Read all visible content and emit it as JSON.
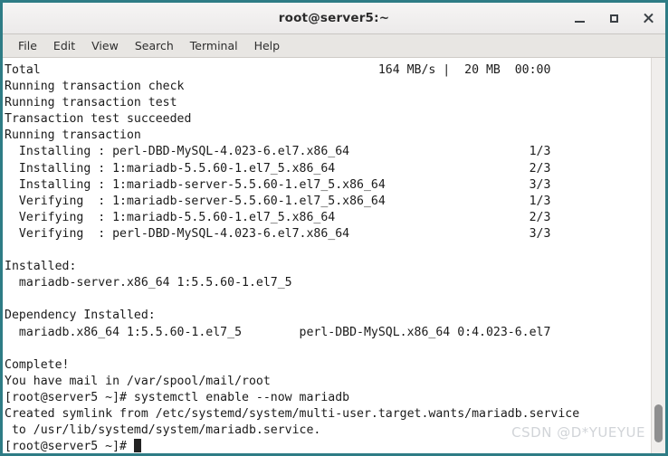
{
  "window": {
    "title": "root@server5:~",
    "border_color": "#2e7c85",
    "controls": {
      "minimize_label": "–",
      "maximize_label": "□",
      "close_label": "✕"
    }
  },
  "menubar": {
    "items": [
      {
        "label": "File"
      },
      {
        "label": "Edit"
      },
      {
        "label": "View"
      },
      {
        "label": "Search"
      },
      {
        "label": "Terminal"
      },
      {
        "label": "Help"
      }
    ]
  },
  "terminal": {
    "background": "#ffffff",
    "foreground": "#1b1b1b",
    "prompt": "[root@server5 ~]#",
    "lines": [
      "Total                                               164 MB/s |  20 MB  00:00",
      "Running transaction check",
      "Running transaction test",
      "Transaction test succeeded",
      "Running transaction",
      "  Installing : perl-DBD-MySQL-4.023-6.el7.x86_64                         1/3",
      "  Installing : 1:mariadb-5.5.60-1.el7_5.x86_64                           2/3",
      "  Installing : 1:mariadb-server-5.5.60-1.el7_5.x86_64                    3/3",
      "  Verifying  : 1:mariadb-server-5.5.60-1.el7_5.x86_64                    1/3",
      "  Verifying  : 1:mariadb-5.5.60-1.el7_5.x86_64                           2/3",
      "  Verifying  : perl-DBD-MySQL-4.023-6.el7.x86_64                         3/3",
      "",
      "Installed:",
      "  mariadb-server.x86_64 1:5.5.60-1.el7_5",
      "",
      "Dependency Installed:",
      "  mariadb.x86_64 1:5.5.60-1.el7_5        perl-DBD-MySQL.x86_64 0:4.023-6.el7",
      "",
      "Complete!",
      "You have mail in /var/spool/mail/root",
      "[root@server5 ~]# systemctl enable --now mariadb",
      "Created symlink from /etc/systemd/system/multi-user.target.wants/mariadb.service",
      " to /usr/lib/systemd/system/mariadb.service."
    ],
    "current_prompt": "[root@server5 ~]# "
  },
  "scrollbar": {
    "orientation": "vertical",
    "thumb_position": "bottom"
  },
  "watermark": {
    "text": "CSDN @D*YUEYUE"
  }
}
